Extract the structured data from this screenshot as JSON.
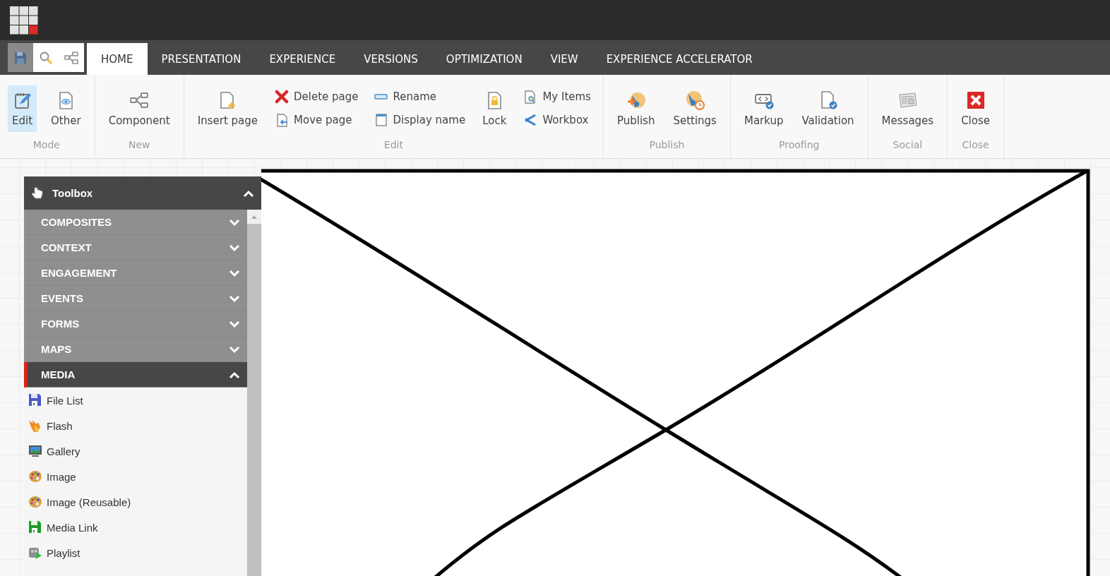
{
  "quick_tools": [
    {
      "selected": true
    },
    {
      "selected": false
    },
    {
      "selected": false
    }
  ],
  "tabs": [
    {
      "label": "HOME",
      "selected": true
    },
    {
      "label": "PRESENTATION",
      "selected": false
    },
    {
      "label": "EXPERIENCE",
      "selected": false
    },
    {
      "label": "VERSIONS",
      "selected": false
    },
    {
      "label": "OPTIMIZATION",
      "selected": false
    },
    {
      "label": "VIEW",
      "selected": false
    },
    {
      "label": "EXPERIENCE ACCELERATOR",
      "selected": false
    }
  ],
  "ribbon": {
    "groups": [
      {
        "label": "Mode",
        "columns": [
          {
            "kind": "large",
            "label": "Edit",
            "selected": true
          },
          {
            "kind": "large",
            "label": "Other",
            "selected": false
          }
        ]
      },
      {
        "label": "New",
        "columns": [
          {
            "kind": "large",
            "label": "Component",
            "selected": false
          }
        ]
      },
      {
        "label": "Edit",
        "columns": [
          {
            "kind": "large",
            "label": "Insert page",
            "selected": false
          },
          {
            "kind": "stack",
            "items": [
              {
                "label": "Delete page"
              },
              {
                "label": "Move page"
              }
            ]
          },
          {
            "kind": "stack",
            "items": [
              {
                "label": "Rename"
              },
              {
                "label": "Display name"
              }
            ]
          },
          {
            "kind": "large",
            "label": "Lock",
            "selected": false
          },
          {
            "kind": "stack",
            "items": [
              {
                "label": "My Items"
              },
              {
                "label": "Workbox"
              }
            ]
          }
        ]
      },
      {
        "label": "Publish",
        "columns": [
          {
            "kind": "large",
            "label": "Publish",
            "selected": false
          },
          {
            "kind": "large",
            "label": "Settings",
            "selected": false
          }
        ]
      },
      {
        "label": "Proofing",
        "columns": [
          {
            "kind": "large",
            "label": "Markup",
            "selected": false
          },
          {
            "kind": "large",
            "label": "Validation",
            "selected": false
          }
        ]
      },
      {
        "label": "Social",
        "columns": [
          {
            "kind": "large",
            "label": "Messages",
            "selected": false
          }
        ]
      },
      {
        "label": "Close",
        "columns": [
          {
            "kind": "large",
            "label": "Close",
            "selected": false
          }
        ]
      }
    ]
  },
  "toolbox": {
    "title": "Toolbox",
    "expanded": true,
    "sections": [
      {
        "label": "COMPOSITES",
        "expanded": false
      },
      {
        "label": "CONTEXT",
        "expanded": false
      },
      {
        "label": "ENGAGEMENT",
        "expanded": false
      },
      {
        "label": "EVENTS",
        "expanded": false
      },
      {
        "label": "FORMS",
        "expanded": false
      },
      {
        "label": "MAPS",
        "expanded": false
      },
      {
        "label": "MEDIA",
        "expanded": true,
        "items": [
          {
            "label": "File List"
          },
          {
            "label": "Flash"
          },
          {
            "label": "Gallery"
          },
          {
            "label": "Image"
          },
          {
            "label": "Image (Reusable)"
          },
          {
            "label": "Media Link"
          },
          {
            "label": "Playlist"
          }
        ]
      }
    ]
  }
}
